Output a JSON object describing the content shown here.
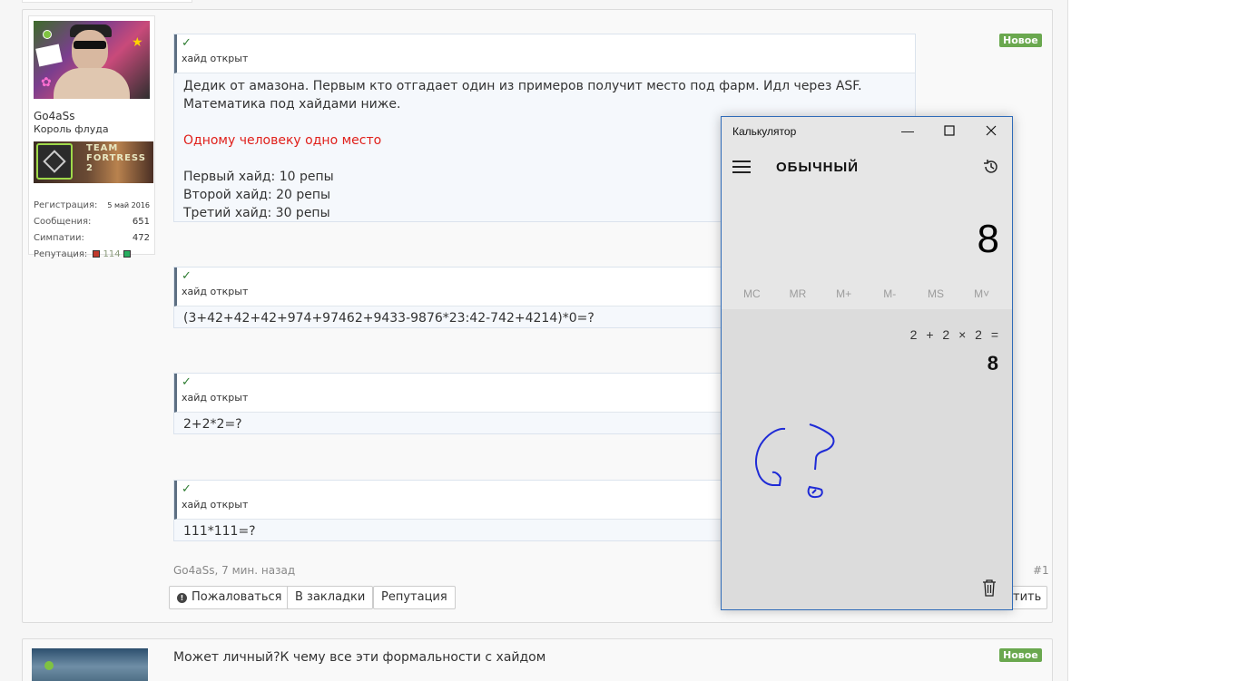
{
  "user": {
    "name": "Go4aSs",
    "title": "Король флуда",
    "stats": [
      {
        "label": "Регистрация:",
        "value": "5 май 2016"
      },
      {
        "label": "Сообщения:",
        "value": "651"
      },
      {
        "label": "Симпатии:",
        "value": "472"
      },
      {
        "label": "Репутация:",
        "value": "114"
      }
    ],
    "banner_text": "TEAM FORTRESS 2"
  },
  "post": {
    "badge": "Новое",
    "hides": [
      {
        "check": "✓",
        "label": "хайд открыт",
        "lines": [
          "Дедик от амазона. Первым кто отгадает один из примеров получит место под фарм. Идл через ASF.",
          "Математика под хайдами ниже.",
          "",
          "Одному человеку одно место",
          "",
          "Первый хайд: 10 репы",
          "Второй хайд: 20 репы",
          "Третий хайд: 30 репы"
        ]
      },
      {
        "check": "✓",
        "label": "хайд открыт",
        "text": "(3+42+42+42+974+97462+9433-9876*23:42-742+4214)*0=?"
      },
      {
        "check": "✓",
        "label": "хайд открыт",
        "text": "2+2*2=?"
      },
      {
        "check": "✓",
        "label": "хайд открыт",
        "text": "111*111=?"
      }
    ],
    "meta": "Go4aSs, 7 мин. назад",
    "number": "#1",
    "buttons": {
      "report": "Пожаловаться",
      "bookmark": "В закладки",
      "reputation": "Репутация",
      "reply_partial": "тить"
    }
  },
  "post2": {
    "badge": "Новое",
    "text": "Может личный?К чему все эти формальности с хайдом"
  },
  "calculator": {
    "title": "Калькулятор",
    "mode": "ОБЫЧНЫЙ",
    "display": "8",
    "memory": [
      "MC",
      "MR",
      "M+",
      "M-",
      "MS",
      "M˅"
    ],
    "expression": "2 + 2 × 2 =",
    "result": "8",
    "ink_color": "#1f2bd6"
  }
}
